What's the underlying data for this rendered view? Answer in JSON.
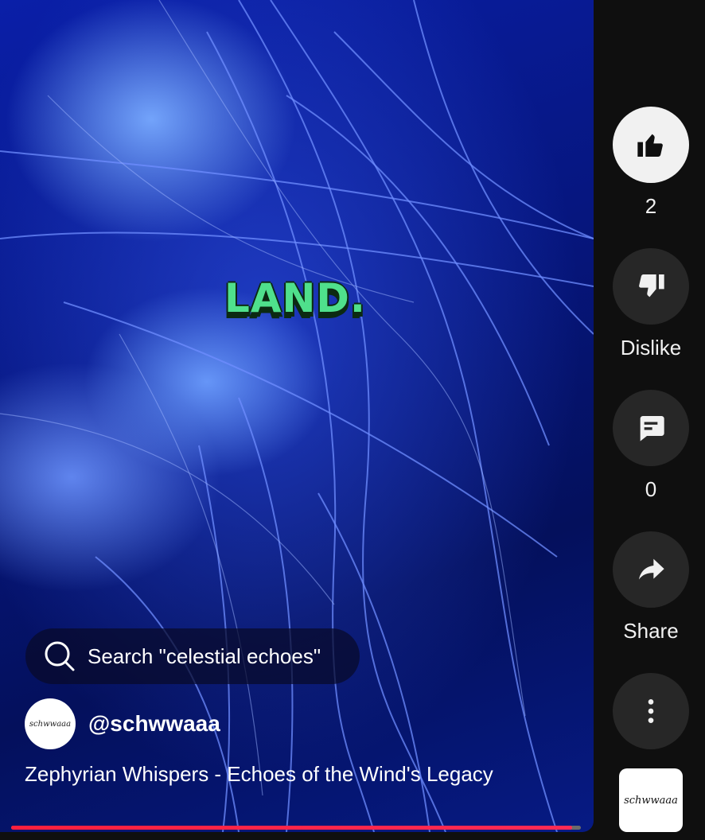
{
  "video": {
    "overlay_word": "LAND.",
    "progress_fraction": 0.985
  },
  "search": {
    "label": "Search \"celestial echoes\""
  },
  "channel": {
    "avatar_text": "schwwaaa",
    "handle": "@schwwaaa"
  },
  "title": "Zephyrian Whispers - Echoes of the Wind's Legacy",
  "actions": {
    "like_count": "2",
    "dislike_label": "Dislike",
    "comment_count": "0",
    "share_label": "Share"
  },
  "sound_thumbnail": {
    "text": "schwwaaa"
  },
  "colors": {
    "progress": "#ff2a55",
    "overlay_text": "#4fe08c",
    "panel_bg": "#0f0f0f",
    "button_bg": "#272727"
  },
  "icons": [
    "search-icon",
    "thumbs-up-icon",
    "thumbs-down-icon",
    "comment-icon",
    "share-icon",
    "more-vertical-icon"
  ]
}
